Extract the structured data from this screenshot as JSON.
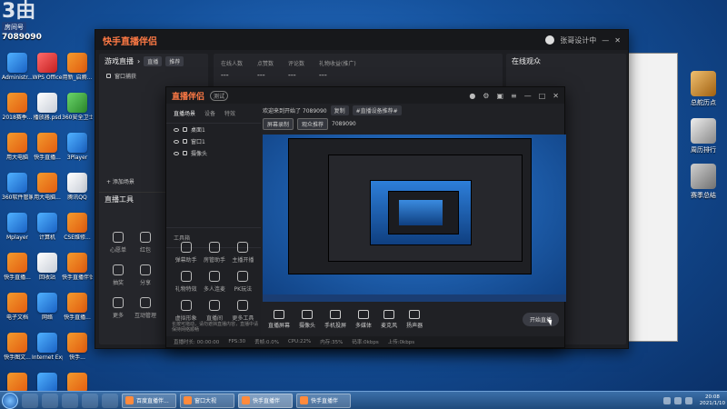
{
  "desktop": {
    "channel_logo_text": "3由",
    "channel_tag": "房间号",
    "channel_number": "7089090",
    "left_icons": [
      {
        "label": "Administr...",
        "color": "blue"
      },
      {
        "label": "WPS Office",
        "color": "red"
      },
      {
        "label": "用新_启腾...",
        "color": ""
      },
      {
        "label": "2018赛季...",
        "color": ""
      },
      {
        "label": "播放器.psd",
        "color": "white"
      },
      {
        "label": "360安全卫士",
        "color": "green"
      },
      {
        "label": "用大电脑",
        "color": ""
      },
      {
        "label": "快手直播...",
        "color": ""
      },
      {
        "label": "3Player",
        "color": "blue"
      },
      {
        "label": "360软件管家",
        "color": "blue"
      },
      {
        "label": "用大电脑...",
        "color": ""
      },
      {
        "label": "腾讯QQ",
        "color": "white"
      },
      {
        "label": "Mplayer",
        "color": "blue"
      },
      {
        "label": "计算机",
        "color": "blue"
      },
      {
        "label": "CSE维修...",
        "color": ""
      },
      {
        "label": "快手直播...",
        "color": ""
      },
      {
        "label": "回收站",
        "color": "white"
      },
      {
        "label": "快手直播伴侣",
        "color": ""
      },
      {
        "label": "电子文档",
        "color": ""
      },
      {
        "label": "网络",
        "color": "blue"
      },
      {
        "label": "快手直播...",
        "color": ""
      },
      {
        "label": "快手图文...",
        "color": ""
      },
      {
        "label": "Internet Explorer",
        "color": "blue"
      },
      {
        "label": "快手...",
        "color": ""
      },
      {
        "label": "游戏中心",
        "color": ""
      },
      {
        "label": "控制面板",
        "color": "blue"
      },
      {
        "label": "快手",
        "color": ""
      },
      {
        "label": "爱奇艺",
        "color": "green"
      },
      {
        "label": "微信",
        "color": "green"
      },
      {
        "label": "飞书",
        "color": "blue"
      },
      {
        "label": "快手直播...",
        "color": ""
      },
      {
        "label": "录屏",
        "color": "dark"
      },
      {
        "label": "Chrome",
        "color": "green"
      },
      {
        "label": "快手...",
        "color": ""
      },
      {
        "label": "快手直播伴侣",
        "color": ""
      }
    ],
    "right_icons": [
      {
        "label": "总舵历点",
        "badge": "10722"
      },
      {
        "label": "周历排行",
        "badge": ""
      },
      {
        "label": "赛季总结",
        "badge": ""
      }
    ]
  },
  "main_window": {
    "title": "快手直播伴侣",
    "user": "张哥设计中",
    "left_section_title": "游戏直播",
    "left_btn1": "直播",
    "left_btn2": "推荐",
    "left_row1": "窗口捕获",
    "left_add": "+ 添加场景",
    "tool_title": "直播工具",
    "stats": [
      {
        "label": "在线人数",
        "value": "---"
      },
      {
        "label": "点赞数",
        "value": "---"
      },
      {
        "label": "评论数",
        "value": "---"
      },
      {
        "label": "礼物收益(推广)",
        "value": "---"
      }
    ],
    "online_title": "在线观众",
    "left_tools": [
      {
        "label": "心愿单"
      },
      {
        "label": "红包"
      },
      {
        "label": "抽奖"
      },
      {
        "label": "分享"
      },
      {
        "label": "更多"
      },
      {
        "label": "互动管理"
      }
    ]
  },
  "live_window": {
    "logo": "直播伴侣",
    "beta": "测试",
    "tabs": [
      "直播场景",
      "设备",
      "特效"
    ],
    "scenes": [
      "桌面1",
      "窗口1",
      "摄像头"
    ],
    "tool_group": "工具箱",
    "tools": [
      {
        "label": "弹幕助手"
      },
      {
        "label": "房管助手"
      },
      {
        "label": "主播开播"
      },
      {
        "label": "礼物特效"
      },
      {
        "label": "多人连麦"
      },
      {
        "label": "PK玩法"
      },
      {
        "label": "虚拟形象"
      },
      {
        "label": "直播间"
      },
      {
        "label": "更多工具"
      }
    ],
    "hint": "长按可拖动，请勿遮挡直播内容，直播中请保持网络顺畅",
    "welcome": "欢迎来到开始了 7089090",
    "chips": [
      "复制",
      "#直播设备推荐#",
      "屏幕录制",
      "观众推荐",
      "7089090"
    ],
    "bottom_tools": [
      {
        "label": "直播屏幕"
      },
      {
        "label": "摄像头"
      },
      {
        "label": "手机投屏"
      },
      {
        "label": "多媒体"
      },
      {
        "label": "麦克风"
      },
      {
        "label": "扬声器"
      }
    ],
    "start_btn": "开始直播",
    "status": [
      "直播时长: 00:00:00",
      "FPS:30",
      "丢帧:0.0%",
      "CPU:22%",
      "内存:35%",
      "码率:0kbps",
      "上传:0kbps"
    ]
  },
  "taskbar": {
    "tasks": [
      {
        "label": "百度直播伴...",
        "active": false
      },
      {
        "label": "窗口大视",
        "active": false
      },
      {
        "label": "快手直播伴",
        "active": true
      },
      {
        "label": "快手直播伴",
        "active": false
      }
    ],
    "time": "20:08",
    "date": "2021/1/10"
  }
}
